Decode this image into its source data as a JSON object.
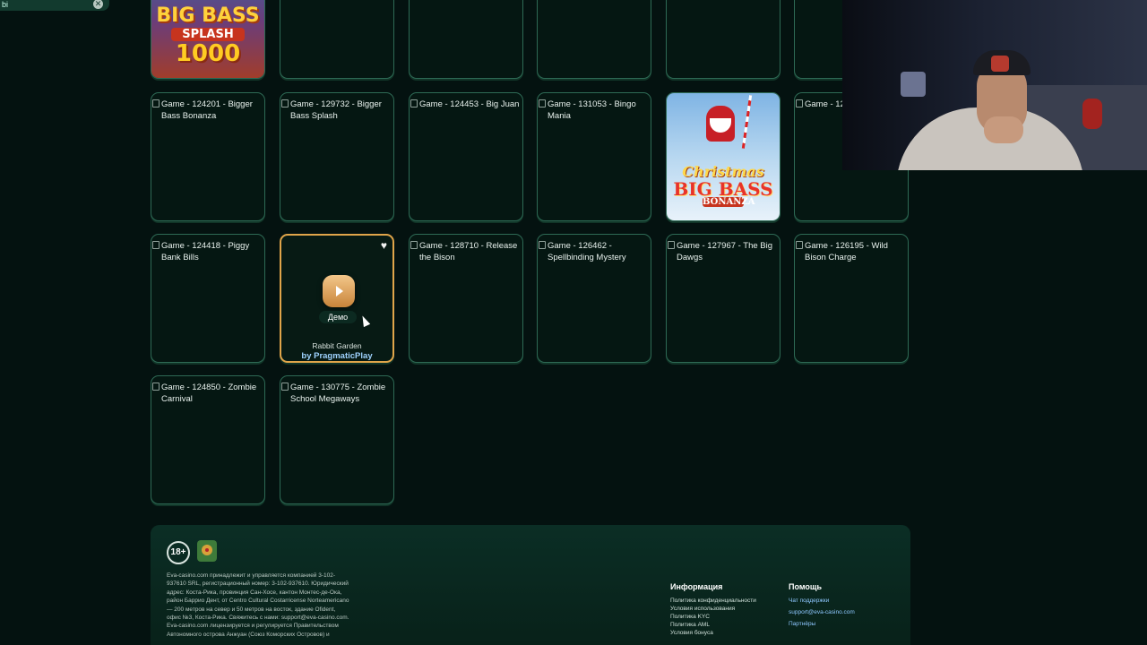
{
  "search": {
    "value": "bi",
    "clear_icon": "✕"
  },
  "games": {
    "row0": [
      "",
      "",
      "",
      "",
      "",
      ""
    ],
    "row1": [
      "Game - 124201 - Bigger Bass Bonanza",
      "Game - 129732 - Bigger Bass Splash",
      "Game - 124453 - Big Juan",
      "Game - 131053 - Bingo Mania",
      "",
      "Game - 1253"
    ],
    "row2": [
      "Game - 124418 - Piggy Bank Bills",
      "",
      "Game - 128710 - Release the Bison",
      "Game - 126462 - Spellbinding Mystery",
      "Game - 127967 - The Big Dawgs",
      "Game - 126195 - Wild Bison Charge"
    ],
    "row3": [
      "Game - 124850 - Zombie Carnival",
      "Game - 130775 - Zombie School Megaways"
    ],
    "active": {
      "heart": "♥",
      "demo_label": "Демо",
      "title": "Rabbit Garden",
      "provider": "by PragmaticPlay"
    },
    "big_bass_art": {
      "line1": "BIG BASS",
      "line2": "SPLASH",
      "line3": "1000"
    },
    "xmas_art": {
      "line1": "Christmas",
      "line2": "BIG BASS",
      "line3": "BONANZA"
    }
  },
  "footer": {
    "age": "18+",
    "legal": "Eva-casino.com принадлежит и управляется компанией 3-102-937610 SRL, регистрационный номер: 3-102-937610. Юридический адрес: Коста-Рика, провинция Сан-Хосе, кантон Монтес-де-Ока, район Баррио Дент, от Centro Cultural Costarricense Norteamericano — 200 метров на север и 50 метров на восток, здание Ofident, офис №3, Коста-Рика. Свяжитесь с нами: support@eva-casino.com. Eva-casino.com лицензируется и регулируется Правительством Автономного острова Анжуан (Союз Коморских Островов) и",
    "info_heading": "Информация",
    "info_links": [
      "Политика конфиденциальности",
      "Условия использования",
      "Политика KYC",
      "Политика AML",
      "Условия бонуса"
    ],
    "help_heading": "Помощь",
    "help_links": [
      "Чат поддержки",
      "support@eva-casino.com",
      "Партнёры"
    ]
  }
}
